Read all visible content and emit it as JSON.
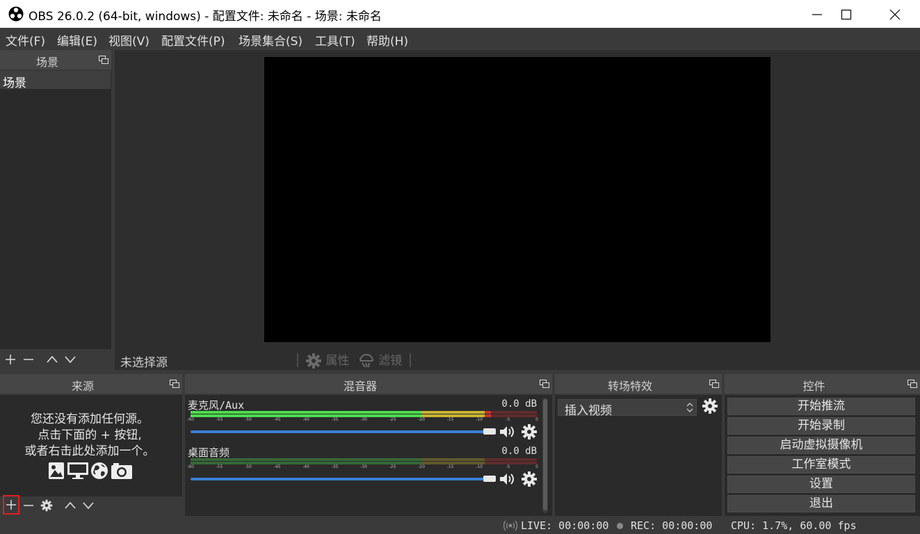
{
  "window": {
    "title": "OBS 26.0.2 (64-bit, windows) - 配置文件: 未命名 - 场景: 未命名"
  },
  "menu": {
    "items": [
      "文件(F)",
      "编辑(E)",
      "视图(V)",
      "配置文件(P)",
      "场景集合(S)",
      "工具(T)",
      "帮助(H)"
    ]
  },
  "scenes": {
    "title": "场景",
    "items": [
      "场景"
    ]
  },
  "properties_bar": {
    "no_source": "未选择源",
    "properties_label": "属性",
    "filters_label": "滤镜"
  },
  "sources": {
    "title": "来源",
    "empty_line1": "您还没有添加任何源。",
    "empty_line2": "点击下面的 + 按钮,",
    "empty_line3": "或者右击此处添加一个。"
  },
  "mixer": {
    "title": "混音器",
    "scale_labels": [
      "-60",
      "-55",
      "-50",
      "-45",
      "-40",
      "-35",
      "-30",
      "-25",
      "-20",
      "-15",
      "-10",
      "-5",
      "0"
    ],
    "channels": [
      {
        "name": "麦克风/Aux",
        "level": "0.0 dB",
        "volume": 1.0,
        "meter_peak_db": -8
      },
      {
        "name": "桌面音频",
        "level": "0.0 dB",
        "volume": 1.0,
        "meter_peak_db": -60
      }
    ]
  },
  "transitions": {
    "title": "转场特效",
    "selected": "插入视频"
  },
  "controls": {
    "title": "控件",
    "buttons": [
      "开始推流",
      "开始录制",
      "启动虚拟摄像机",
      "工作室模式",
      "设置",
      "退出"
    ]
  },
  "status": {
    "live": "LIVE: 00:00:00",
    "rec": "REC: 00:00:00",
    "cpu": "CPU: 1.7%, 60.00 fps"
  },
  "colors": {
    "meter_green": "#4cdc4c",
    "meter_yellow": "#c8b432",
    "meter_red": "#c83232",
    "slider_blue": "#3b7fd6",
    "highlight_box": "#e02020"
  }
}
